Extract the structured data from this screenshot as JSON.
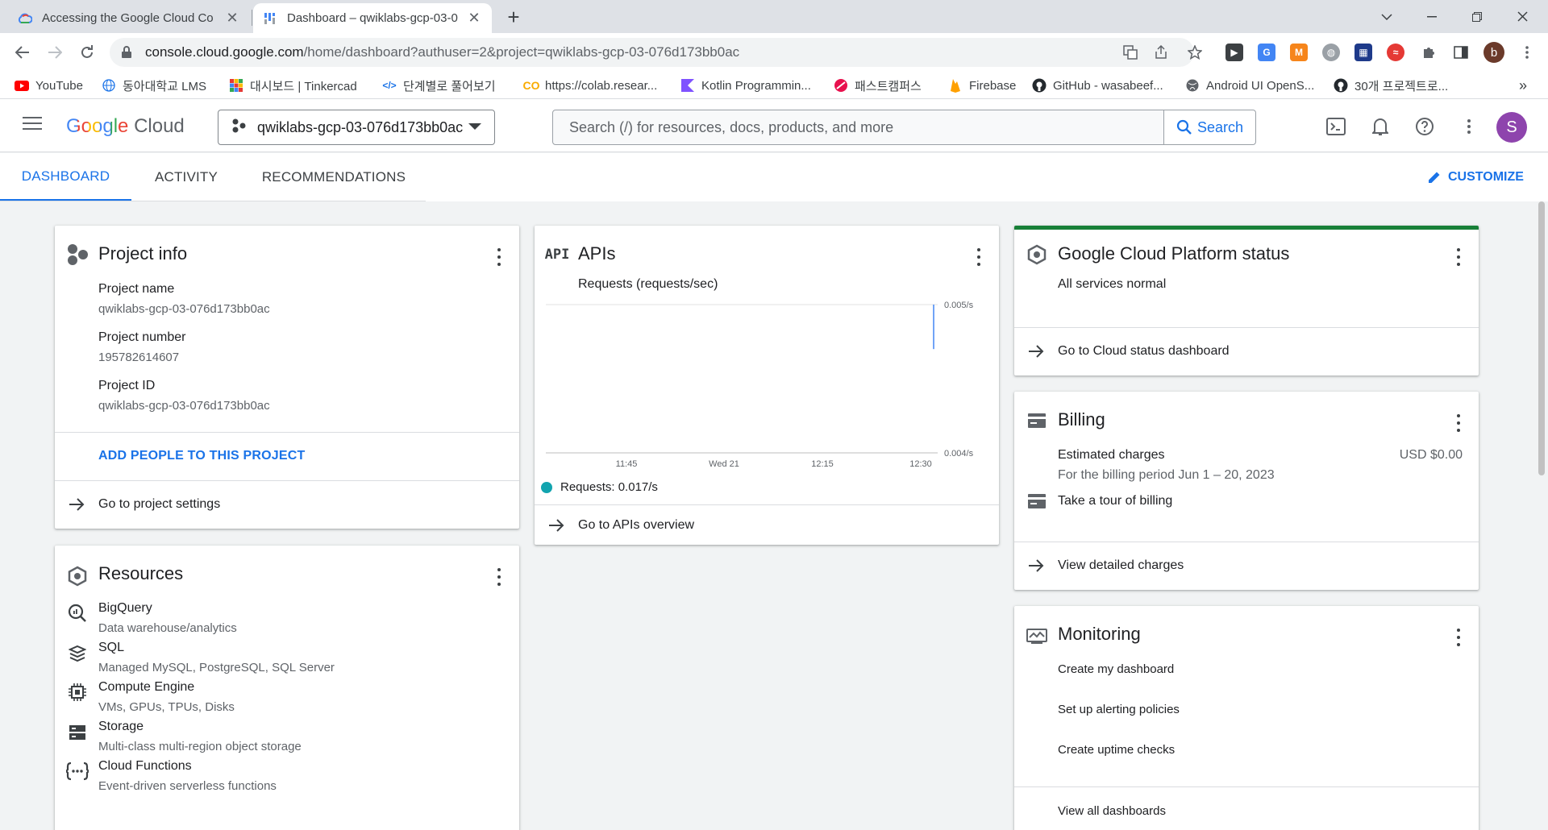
{
  "browser": {
    "tabs": [
      {
        "title": "Accessing the Google Cloud Co",
        "active": false
      },
      {
        "title": "Dashboard – qwiklabs-gcp-03-0",
        "active": true
      }
    ],
    "url_host": "console.cloud.google.com",
    "url_path": "/home/dashboard?authuser=2&project=qwiklabs-gcp-03-076d173bb0ac",
    "profile_initial": "b",
    "bookmarks": [
      "YouTube",
      "동아대학교 LMS",
      "대시보드 | Tinkercad",
      "단계별로 풀어보기",
      "https://colab.resear...",
      "Kotlin Programmin...",
      "패스트캠퍼스",
      "Firebase",
      "GitHub - wasabeef...",
      "Android UI OpenS...",
      "30개 프로젝트로..."
    ],
    "bookmarks_more": "»"
  },
  "header": {
    "logo_google": "Google",
    "logo_cloud": "Cloud",
    "project": "qwiklabs-gcp-03-076d173bb0ac",
    "search_placeholder": "Search (/) for resources, docs, products, and more",
    "search_button": "Search",
    "avatar_initial": "S"
  },
  "tabs": {
    "dashboard": "DASHBOARD",
    "activity": "ACTIVITY",
    "recommendations": "RECOMMENDATIONS",
    "customize": "CUSTOMIZE"
  },
  "project_info": {
    "title": "Project info",
    "name_label": "Project name",
    "name_value": "qwiklabs-gcp-03-076d173bb0ac",
    "number_label": "Project number",
    "number_value": "195782614607",
    "id_label": "Project ID",
    "id_value": "qwiklabs-gcp-03-076d173bb0ac",
    "add_people": "ADD PEOPLE TO THIS PROJECT",
    "settings_link": "Go to project settings"
  },
  "resources": {
    "title": "Resources",
    "items": [
      {
        "name": "BigQuery",
        "desc": "Data warehouse/analytics"
      },
      {
        "name": "SQL",
        "desc": "Managed MySQL, PostgreSQL, SQL Server"
      },
      {
        "name": "Compute Engine",
        "desc": "VMs, GPUs, TPUs, Disks"
      },
      {
        "name": "Storage",
        "desc": "Multi-class multi-region object storage"
      },
      {
        "name": "Cloud Functions",
        "desc": "Event-driven serverless functions"
      }
    ]
  },
  "apis": {
    "icon_text": "API",
    "title": "APIs",
    "chart_title": "Requests (requests/sec)",
    "legend_label": "Requests:",
    "legend_value": "0.017/s",
    "overview_link": "Go to APIs overview"
  },
  "chart_data": {
    "type": "line",
    "title": "Requests (requests/sec)",
    "x_ticks": [
      "11:45",
      "Wed 21",
      "12:15",
      "12:30"
    ],
    "y_ticks": [
      "0.005/s",
      "0.004/s"
    ],
    "series": [
      {
        "name": "Requests",
        "color": "#4285f4",
        "points": [
          {
            "x": "12:35",
            "y": 0.005
          },
          {
            "x": "12:35",
            "y": 0.0047
          }
        ]
      }
    ],
    "legend_value": "0.017/s"
  },
  "status": {
    "title": "Google Cloud Platform status",
    "message": "All services normal",
    "link": "Go to Cloud status dashboard",
    "accent": "#188038"
  },
  "billing": {
    "title": "Billing",
    "charges_label": "Estimated charges",
    "charges_value": "USD $0.00",
    "period": "For the billing period Jun 1 – 20, 2023",
    "tour": "Take a tour of billing",
    "detailed": "View detailed charges"
  },
  "monitoring": {
    "title": "Monitoring",
    "items": [
      "Create my dashboard",
      "Set up alerting policies",
      "Create uptime checks"
    ],
    "view_all": "View all dashboards"
  },
  "colors": {
    "accent_blue": "#1a73e8",
    "legend_teal": "#12a4af"
  }
}
